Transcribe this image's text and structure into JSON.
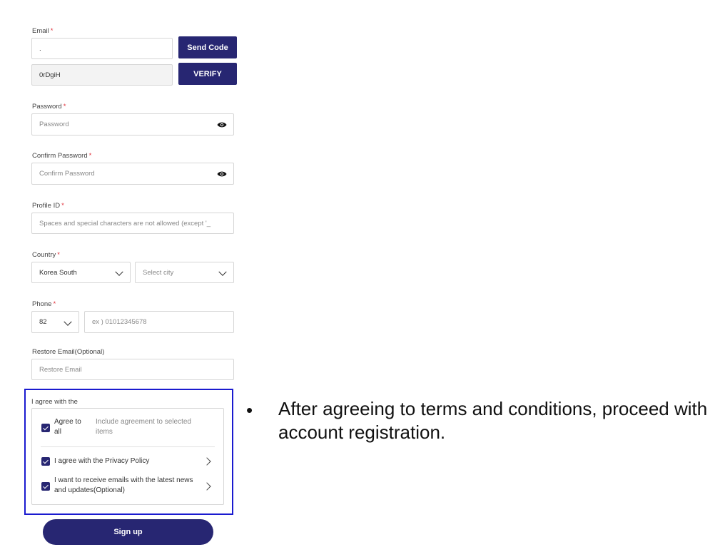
{
  "email": {
    "label": "Email",
    "value": ".",
    "send_code": "Send Code",
    "code_value": "0rDgiH",
    "verify": "VERIFY"
  },
  "password": {
    "label": "Password",
    "placeholder": "Password"
  },
  "confirm": {
    "label": "Confirm Password",
    "placeholder": "Confirm Password"
  },
  "profile": {
    "label": "Profile ID",
    "placeholder": "Spaces and special characters are not allowed (except '_"
  },
  "country": {
    "label": "Country",
    "selected": "Korea South",
    "city_placeholder": "Select city"
  },
  "phone": {
    "label": "Phone",
    "code": "82",
    "placeholder": "ex ) 01012345678"
  },
  "restore": {
    "label": "Restore Email(Optional)",
    "placeholder": "Restore Email"
  },
  "agree": {
    "header": "I agree with the",
    "all_label": "Agree to all",
    "all_desc": "Include agreement to selected items",
    "privacy": "I agree with the Privacy Policy",
    "news": "I want to receive emails with the latest news and updates(Optional)"
  },
  "signup": "Sign up",
  "note": "After agreeing to terms and conditions, proceed with account registration.",
  "colors": {
    "primary": "#272672",
    "highlight_border": "#1a1acf",
    "required": "#e0303a"
  }
}
